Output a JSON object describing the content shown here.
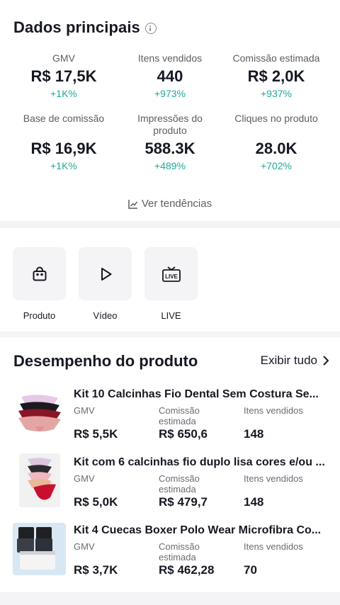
{
  "main": {
    "title": "Dados principais",
    "metrics": [
      {
        "label": "GMV",
        "value": "R$ 17,5K",
        "change": "+1K%"
      },
      {
        "label": "Itens vendidos",
        "value": "440",
        "change": "+973%"
      },
      {
        "label": "Comissão estimada",
        "value": "R$ 2,0K",
        "change": "+937%"
      },
      {
        "label": "Base de comissão",
        "value": "R$ 16,9K",
        "change": "+1K%"
      },
      {
        "label": "Impressões do produto",
        "value": "588.3K",
        "change": "+489%"
      },
      {
        "label": "Cliques no produto",
        "value": "28.0K",
        "change": "+702%"
      }
    ],
    "trend_link": "Ver tendências"
  },
  "tabs": [
    {
      "label": "Produto",
      "icon": "shopping-bag-icon"
    },
    {
      "label": "Vídeo",
      "icon": "play-icon"
    },
    {
      "label": "LIVE",
      "icon": "live-tv-icon"
    }
  ],
  "performance": {
    "title": "Desempenho do produto",
    "see_all": "Exibir tudo",
    "col_labels": {
      "gmv": "GMV",
      "commission": "Comissão estimada",
      "items": "Itens vendidos"
    },
    "products": [
      {
        "name": "Kit 10 Calcinhas Fio Dental Sem Costura Se...",
        "gmv": "R$ 5,5K",
        "commission": "R$ 650,6",
        "items": "148"
      },
      {
        "name": "Kit com 6 calcinhas fio duplo lisa cores e/ou ...",
        "gmv": "R$ 5,0K",
        "commission": "R$ 479,7",
        "items": "148"
      },
      {
        "name": "Kit 4 Cuecas Boxer Polo Wear Microfibra Co...",
        "gmv": "R$ 3,7K",
        "commission": "R$ 462,28",
        "items": "70"
      }
    ]
  },
  "colors": {
    "positive": "#20a99a",
    "text": "#161823",
    "muted": "#5c5d63"
  }
}
